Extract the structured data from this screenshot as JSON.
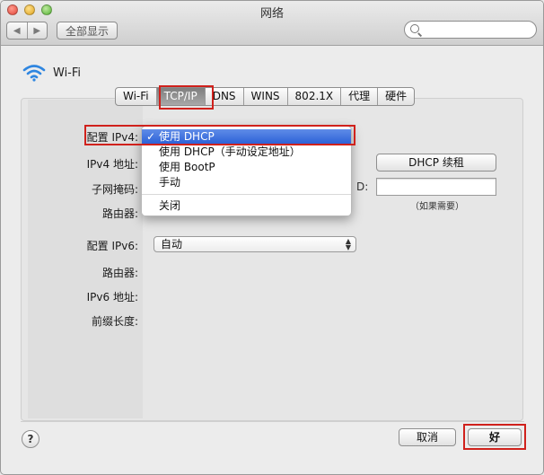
{
  "window": {
    "title": "网络"
  },
  "toolbar": {
    "show_all_label": "全部显示",
    "search_placeholder": ""
  },
  "interface": {
    "name": "Wi-Fi"
  },
  "tabs": [
    {
      "label": "Wi-Fi",
      "active": false
    },
    {
      "label": "TCP/IP",
      "active": true
    },
    {
      "label": "DNS",
      "active": false
    },
    {
      "label": "WINS",
      "active": false
    },
    {
      "label": "802.1X",
      "active": false
    },
    {
      "label": "代理",
      "active": false
    },
    {
      "label": "硬件",
      "active": false
    }
  ],
  "ipv4": {
    "config_label": "配置 IPv4:",
    "address_label": "IPv4 地址:",
    "subnet_label": "子网掩码:",
    "router_label": "路由器:",
    "menu": {
      "selected": "使用 DHCP",
      "options": [
        "使用 DHCP",
        "使用 DHCP（手动设定地址）",
        "使用 BootP",
        "手动",
        "关闭"
      ]
    },
    "renew_button": "DHCP 续租",
    "dhcp_client_id_label": "D:",
    "client_id_hint": "（如果需要）"
  },
  "ipv6": {
    "config_label": "配置 IPv6:",
    "config_value": "自动",
    "router_label": "路由器:",
    "address_label": "IPv6 地址:",
    "prefix_label": "前缀长度:"
  },
  "footer": {
    "help_label": "?",
    "cancel_label": "取消",
    "ok_label": "好"
  },
  "colors": {
    "highlight": "#d0211c",
    "selection": "#2a5fd6"
  }
}
